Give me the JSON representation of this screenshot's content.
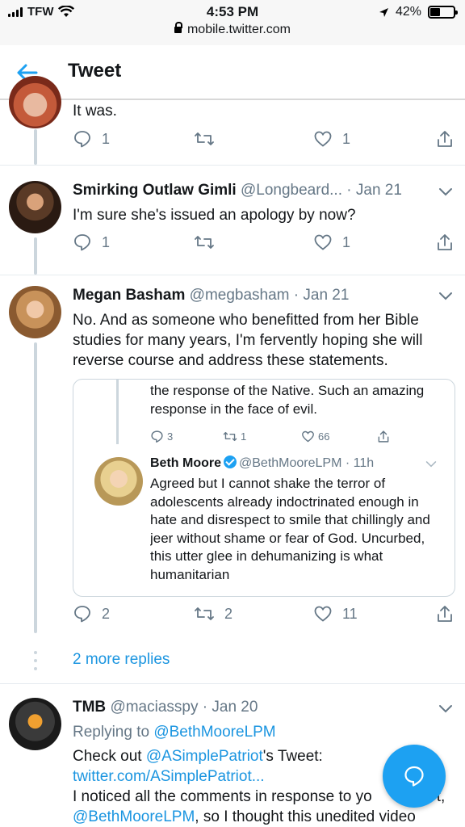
{
  "status_bar": {
    "carrier": "TFW",
    "time": "4:53 PM",
    "battery_text": "42%",
    "battery_level": 0.42,
    "url": "mobile.twitter.com"
  },
  "header": {
    "title": "Tweet"
  },
  "tweets": [
    {
      "text": "It was.",
      "replies": "1",
      "retweets": "",
      "likes": "1"
    },
    {
      "name": "Smirking Outlaw Gimli",
      "handle": "@Longbeard...",
      "date": "· Jan 21",
      "text": "I'm sure she's issued an apology by now?",
      "replies": "1",
      "retweets": "",
      "likes": "1"
    },
    {
      "name": "Megan Basham",
      "handle": "@megbasham",
      "date": "· Jan 21",
      "text": "No. And as someone who benefitted from her Bible studies for many years, I'm fervently hoping she will reverse course and address these statements.",
      "replies": "2",
      "retweets": "2",
      "likes": "11"
    }
  ],
  "quote": {
    "top_text": "the response of the Native. Such an amazing response in the face of evil.",
    "replies": "3",
    "retweets": "1",
    "likes": "66",
    "name": "Beth Moore",
    "handle": "@BethMooreLPM",
    "date": "· 11h",
    "text": "Agreed but I cannot shake the terror of adolescents already indoctrinated enough in hate and disrespect to smile that chillingly and jeer without shame or fear of God. Uncurbed, this utter glee in dehumanizing is what humanitarian"
  },
  "more_replies": "2 more replies",
  "reply_tweet": {
    "name": "TMB",
    "handle": "@maciasspy",
    "date": "· Jan 20",
    "replying_prefix": "Replying to",
    "replying_to": "@BethMooreLPM",
    "line1_prefix": "Check out",
    "line1_mention": "@ASimplePatriot",
    "line1_suffix": "'s Tweet:",
    "link": "twitter.com/ASimplePatriot...",
    "line3": "I noticed all the comments in response to yo",
    "line3_tail": "t,",
    "line4_mention": "@BethMooreLPM",
    "line4_suffix": ", so I thought this unedited video"
  },
  "colors": {
    "accent": "#1da1f2",
    "link": "#1b95e0",
    "muted": "#657786",
    "border": "#ccd6dd"
  }
}
